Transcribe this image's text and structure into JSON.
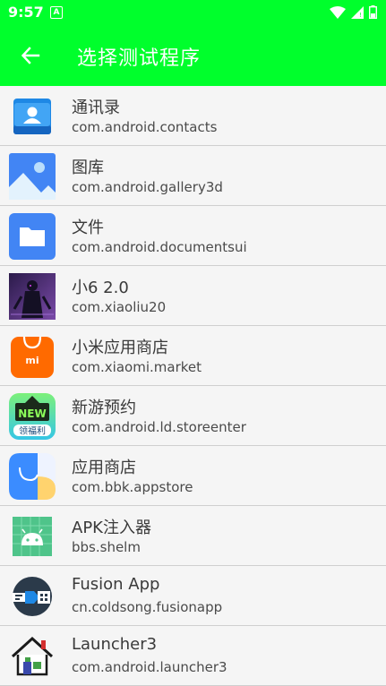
{
  "status_bar": {
    "time": "9:57",
    "notification_letter": "A"
  },
  "app_bar": {
    "title": "选择测试程序"
  },
  "apps": [
    {
      "name": "通讯录",
      "package": "com.android.contacts",
      "icon": "contacts-icon"
    },
    {
      "name": "图库",
      "package": "com.android.gallery3d",
      "icon": "gallery-icon"
    },
    {
      "name": "文件",
      "package": "com.android.documentsui",
      "icon": "files-icon"
    },
    {
      "name": "小6 2.0",
      "package": "com.xiaoliu20",
      "icon": "xiaoliu-icon"
    },
    {
      "name": "小米应用商店",
      "package": "com.xiaomi.market",
      "icon": "xiaomi-market-icon"
    },
    {
      "name": "新游预约",
      "package": "com.android.ld.storeenter",
      "icon": "new-game-icon",
      "badge_top": "NEW",
      "badge_bottom": "领福利"
    },
    {
      "name": "应用商店",
      "package": "com.bbk.appstore",
      "icon": "appstore-icon"
    },
    {
      "name": "APK注入器",
      "package": "bbs.shelm",
      "icon": "apk-injector-icon"
    },
    {
      "name": "Fusion App",
      "package": "cn.coldsong.fusionapp",
      "icon": "fusion-app-icon"
    },
    {
      "name": "Launcher3",
      "package": "com.android.launcher3",
      "icon": "launcher-icon"
    }
  ],
  "colors": {
    "accent": "#00ff2c",
    "background": "#f5f5f5",
    "divider": "#cfcfcf"
  }
}
